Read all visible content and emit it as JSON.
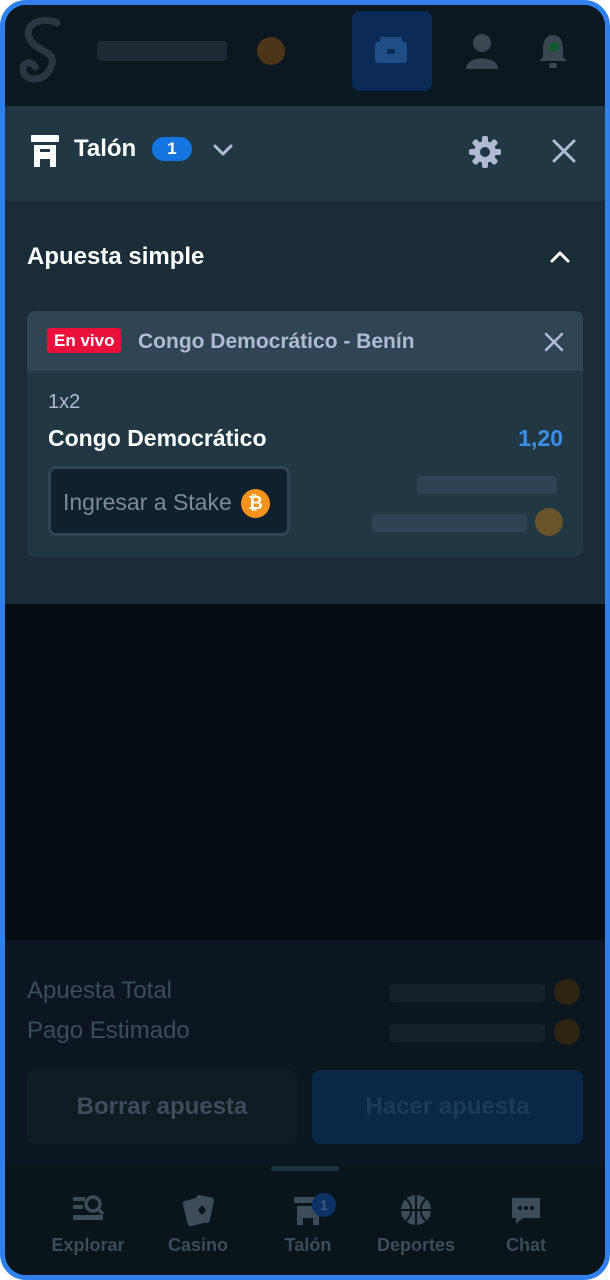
{
  "header": {
    "logo_icon": "stake-s-logo-icon",
    "wallet_icon": "wallet-icon",
    "user_icon": "user-icon",
    "bell_icon": "bell-icon"
  },
  "betslip": {
    "title": "Talón",
    "count": "1",
    "section_title": "Apuesta simple",
    "bet": {
      "live_badge": "En vivo",
      "match": "Congo Democrático - Benín",
      "market": "1x2",
      "selection": "Congo Democrático",
      "odds": "1,20",
      "stake_placeholder": "Ingresar a Stake",
      "currency_icon": "bitcoin-icon"
    }
  },
  "summary": {
    "total_label": "Apuesta Total",
    "payout_label": "Pago Estimado",
    "clear_button": "Borrar apuesta",
    "place_button": "Hacer apuesta"
  },
  "nav": {
    "items": [
      {
        "label": "Explorar",
        "icon": "browse-icon"
      },
      {
        "label": "Casino",
        "icon": "cards-icon"
      },
      {
        "label": "Talón",
        "icon": "betslip-icon",
        "badge": "1"
      },
      {
        "label": "Deportes",
        "icon": "basketball-icon"
      },
      {
        "label": "Chat",
        "icon": "chat-icon"
      }
    ]
  },
  "colors": {
    "frame": "#2f80ed",
    "accent": "#1475e1",
    "odds": "#3b8fe8",
    "live": "#e9113c",
    "bitcoin": "#f7931a"
  }
}
